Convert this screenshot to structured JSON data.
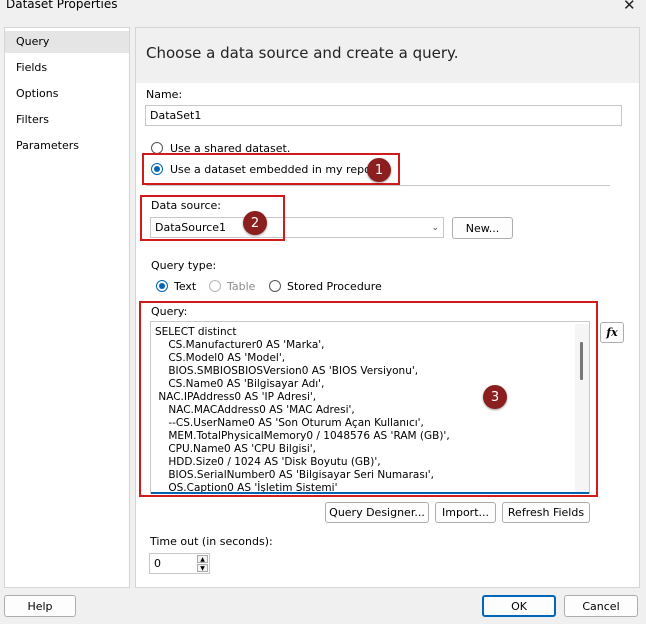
{
  "window": {
    "title": "Dataset Properties",
    "close_glyph": "✕"
  },
  "nav": {
    "items": [
      "Query",
      "Fields",
      "Options",
      "Filters",
      "Parameters"
    ]
  },
  "header": {
    "text": "Choose a data source and create a query."
  },
  "name": {
    "label": "Name:",
    "value": "DataSet1"
  },
  "dataset_choice": {
    "shared_label": "Use a shared dataset.",
    "embedded_label": "Use a dataset embedded in my report.",
    "selected": "embedded"
  },
  "data_source": {
    "label": "Data source:",
    "value": "DataSource1",
    "new_button": "New..."
  },
  "query_type": {
    "label": "Query type:",
    "options": [
      "Text",
      "Table",
      "Stored Procedure"
    ],
    "selected": "Text",
    "disabled": [
      "Table"
    ]
  },
  "query": {
    "label": "Query:",
    "lines": [
      "SELECT distinct",
      "    CS.Manufacturer0 AS 'Marka',",
      "    CS.Model0 AS 'Model',",
      "    BIOS.SMBIOSBIOSVersion0 AS 'BIOS Versiyonu',",
      "    CS.Name0 AS 'Bilgisayar Adı',",
      " NAC.IPAddress0 AS 'IP Adresi',",
      "    NAC.MACAddress0 AS 'MAC Adresi',",
      "    --CS.UserName0 AS 'Son Oturum Açan Kullanıcı',",
      "    MEM.TotalPhysicalMemory0 / 1048576 AS 'RAM (GB)',",
      "    CPU.Name0 AS 'CPU Bilgisi',",
      "    HDD.Size0 / 1024 AS 'Disk Boyutu (GB)',",
      "    BIOS.SerialNumber0 AS 'Bilgisayar Seri Numarası',",
      "    OS.Caption0 AS 'İşletim Sistemi'"
    ],
    "fx_label": "fx",
    "buttons": {
      "designer": "Query Designer...",
      "import": "Import...",
      "refresh": "Refresh Fields"
    }
  },
  "timeout": {
    "label": "Time out (in seconds):",
    "value": "0"
  },
  "footer": {
    "help": "Help",
    "ok": "OK",
    "cancel": "Cancel"
  },
  "callouts": [
    "1",
    "2",
    "3"
  ],
  "colors": {
    "callout_border": "#d11b1b",
    "callout_badge": "#8b1e1e",
    "accent": "#0066b8"
  }
}
